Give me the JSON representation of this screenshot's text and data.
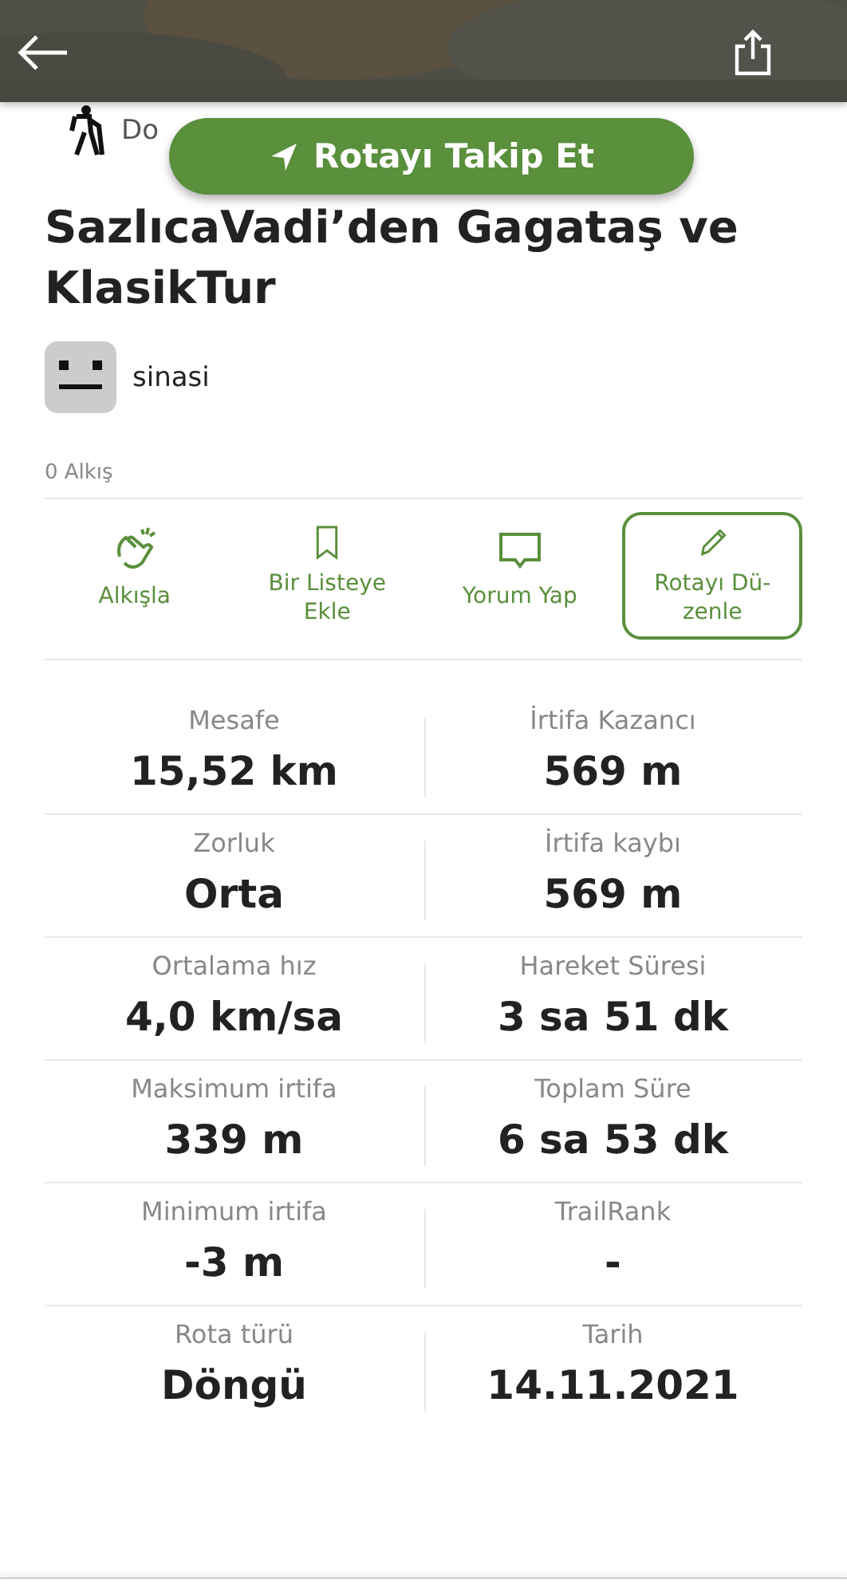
{
  "category": {
    "label": "Do"
  },
  "follow_button": {
    "label": "Rotayı Takip Et"
  },
  "title": "SazlıcaVadi’den Gagataş ve KlasikTur",
  "author": {
    "name": "sinasi"
  },
  "applause_count": "0 Alkış",
  "actions": [
    {
      "kind": "clap",
      "label": "Alkışla",
      "outlined": false
    },
    {
      "kind": "bookmark",
      "label": "Bir Listeye Ekle",
      "outlined": false
    },
    {
      "kind": "comment",
      "label": "Yorum Yap",
      "outlined": false
    },
    {
      "kind": "edit",
      "label": "Rotayı Dü-zenle",
      "outlined": true
    }
  ],
  "stats": [
    {
      "label": "Mesafe",
      "value": "15,52 km"
    },
    {
      "label": "İrtifa Kazancı",
      "value": "569 m"
    },
    {
      "label": "Zorluk",
      "value": "Orta"
    },
    {
      "label": "İrtifa kaybı",
      "value": "569 m"
    },
    {
      "label": "Ortalama hız",
      "value": "4,0 km/sa"
    },
    {
      "label": "Hareket Süresi",
      "value": "3 sa 51 dk"
    },
    {
      "label": "Maksimum irtifa",
      "value": "339 m"
    },
    {
      "label": "Toplam Süre",
      "value": "6 sa 53 dk"
    },
    {
      "label": "Minimum irtifa",
      "value": "-3 m"
    },
    {
      "label": "TrailRank",
      "value": "-"
    },
    {
      "label": "Rota türü",
      "value": "Döngü"
    },
    {
      "label": "Tarih",
      "value": "14.11.2021"
    }
  ]
}
